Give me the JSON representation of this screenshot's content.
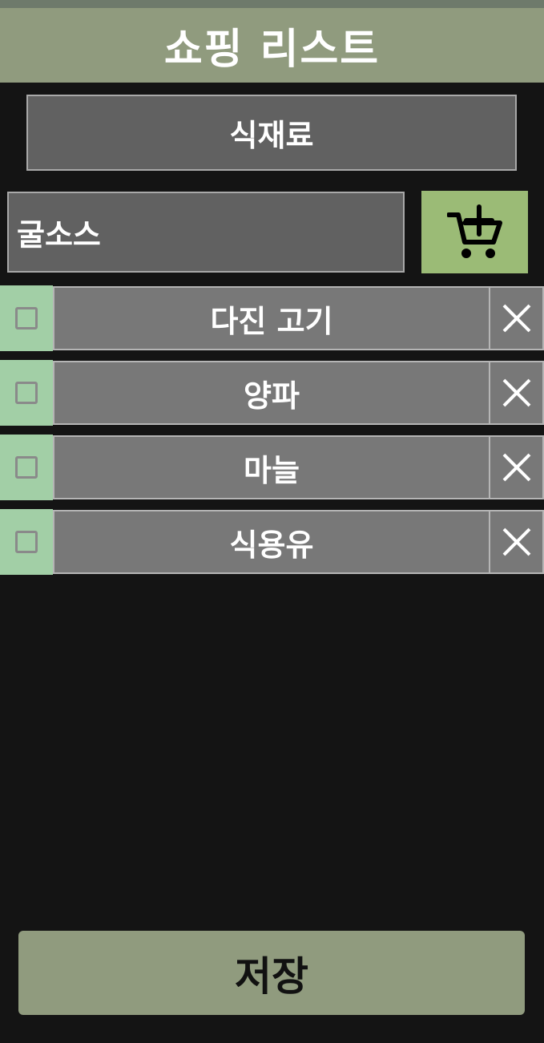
{
  "header": {
    "title": "쇼핑 리스트"
  },
  "category": {
    "label": "식재료"
  },
  "item_input": {
    "value": "굴소스"
  },
  "add_button": {
    "icon": "cart-plus-icon"
  },
  "items": [
    {
      "label": "다진 고기",
      "checked": false
    },
    {
      "label": "양파",
      "checked": false
    },
    {
      "label": "마늘",
      "checked": false
    },
    {
      "label": "식용유",
      "checked": false
    }
  ],
  "save_button": {
    "label": "저장"
  },
  "colors": {
    "title_bar": "#909b7e",
    "add_button": "#9bbb76",
    "check_cell": "#a2cfa6",
    "item_cell": "#787878",
    "background": "#141414"
  }
}
